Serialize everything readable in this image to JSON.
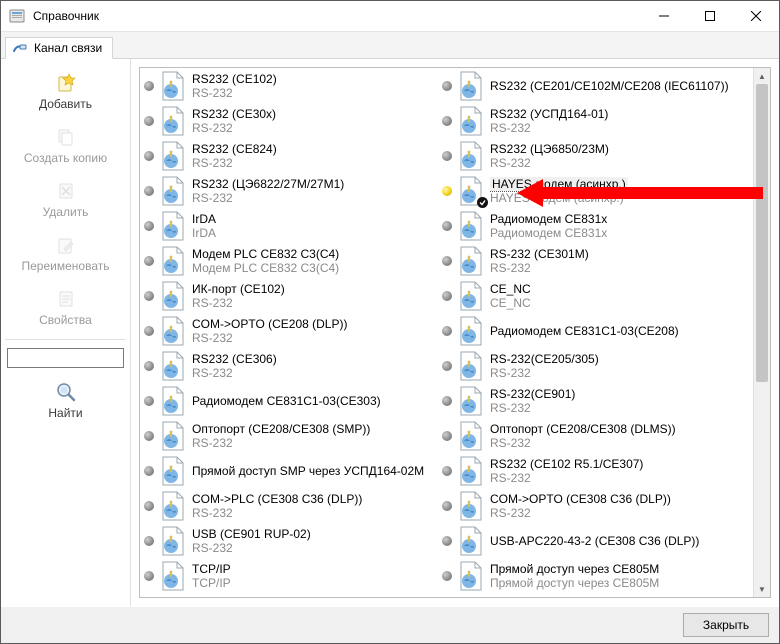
{
  "window": {
    "title": "Справочник"
  },
  "tab": {
    "label": "Канал связи"
  },
  "sidebar": {
    "add": "Добавить",
    "copy": "Создать копию",
    "delete": "Удалить",
    "rename": "Переименовать",
    "props": "Свойства",
    "find": "Найти"
  },
  "search": {
    "value": "",
    "placeholder": ""
  },
  "footer": {
    "close": "Закрыть"
  },
  "items": [
    {
      "title": "RS232 (CE102)",
      "sub": "RS-232"
    },
    {
      "title": "RS232 (CE30x)",
      "sub": "RS-232"
    },
    {
      "title": "RS232 (CE824)",
      "sub": "RS-232"
    },
    {
      "title": "RS232 (ЦЭ6822/27М/27М1)",
      "sub": "RS-232"
    },
    {
      "title": "IrDA",
      "sub": "IrDA"
    },
    {
      "title": "Модем PLC CE832 C3(C4)",
      "sub": "Модем PLC CE832 C3(C4)"
    },
    {
      "title": "ИК-порт (CE102)",
      "sub": "RS-232"
    },
    {
      "title": "COM->OPTO (CE208 (DLP))",
      "sub": "RS-232"
    },
    {
      "title": "RS232 (CE306)",
      "sub": "RS-232"
    },
    {
      "title": "Радиомодем CE831C1-03(CE303)",
      "sub": ""
    },
    {
      "title": "Оптопорт (CE208/CE308 (SMP))",
      "sub": "RS-232"
    },
    {
      "title": "Прямой доступ SMP через УСПД164-02М",
      "sub": ""
    },
    {
      "title": "COM->PLC (CE308 C36 (DLP))",
      "sub": "RS-232"
    },
    {
      "title": "USB (CE901 RUP-02)",
      "sub": "RS-232"
    },
    {
      "title": "TCP/IP",
      "sub": "TCP/IP"
    },
    {
      "title": "RS232 (CE201/CE102M/CE208 (IEC61107))",
      "sub": ""
    },
    {
      "title": "RS232 (УСПД164-01)",
      "sub": "RS-232"
    },
    {
      "title": "RS232 (ЦЭ6850/23М)",
      "sub": "RS-232"
    },
    {
      "title": "HAYES-модем (асинхр.)",
      "sub": "HAYES-модем (асинхр.)",
      "selected": true,
      "yellow": true,
      "check": true
    },
    {
      "title": "Радиомодем CE831x",
      "sub": "Радиомодем CE831x"
    },
    {
      "title": "RS-232 (CE301M)",
      "sub": "RS-232"
    },
    {
      "title": "CE_NC",
      "sub": "CE_NC"
    },
    {
      "title": "Радиомодем CE831C1-03(CE208)",
      "sub": ""
    },
    {
      "title": "RS-232(CE205/305)",
      "sub": "RS-232"
    },
    {
      "title": "RS-232(CE901)",
      "sub": "RS-232"
    },
    {
      "title": "Оптопорт (CE208/CE308 (DLMS))",
      "sub": "RS-232"
    },
    {
      "title": "RS232 (CE102 R5.1/CE307)",
      "sub": "RS-232"
    },
    {
      "title": "COM->OPTO (CE308 C36 (DLP))",
      "sub": "RS-232"
    },
    {
      "title": "USB-APC220-43-2 (CE308 C36 (DLP))",
      "sub": ""
    },
    {
      "title": "Прямой доступ через CE805M",
      "sub": "Прямой доступ через CE805M"
    }
  ]
}
